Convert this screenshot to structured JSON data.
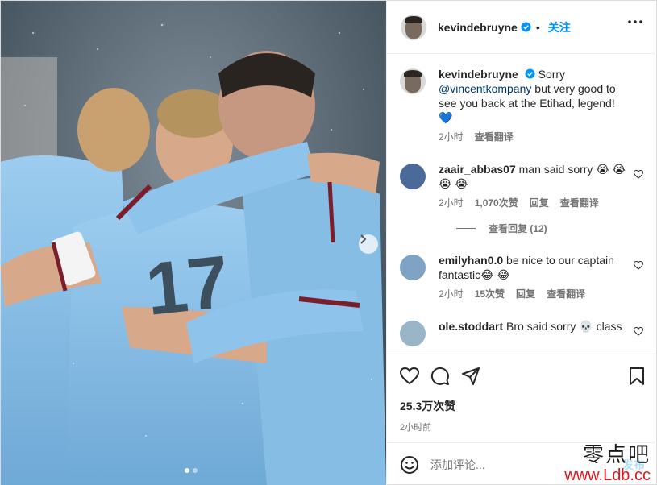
{
  "colors": {
    "accent": "#0095f6",
    "verified": "#0095f6",
    "shirt": "#8ec4ec",
    "maroon": "#7a1e2c",
    "watermark_red": "#e3171c"
  },
  "post": {
    "image_alt": "Manchester City players celebrating in the rain",
    "carousel": {
      "count": 2,
      "active": 0
    },
    "next_icon": "chevron-right-icon"
  },
  "header": {
    "username": "kevindebruyne",
    "verified_icon": "verified-badge-icon",
    "separator": "•",
    "follow_label": "关注",
    "more_icon": "more-horizontal-icon"
  },
  "caption": {
    "username": "kevindebruyne",
    "text_before": "Sorry ",
    "mention": "@vincentkompany",
    "text_after": " but very good to see you back at the Etihad, legend! 💙",
    "time": "2小时",
    "translate": "查看翻译"
  },
  "comments": [
    {
      "username": "zaair_abbas07",
      "text": "man said sorry 😭 😭 😭 😭",
      "time": "2小时",
      "likes": "1,070次赞",
      "reply": "回复",
      "translate": "查看翻译",
      "view_replies": "查看回复 (12)"
    },
    {
      "username": "emilyhan0.0",
      "text": "be nice to our captain fantastic😂 😂",
      "time": "2小时",
      "likes": "15次赞",
      "reply": "回复",
      "translate": "查看翻译"
    },
    {
      "username": "ole.stoddart",
      "text": "Bro said sorry 💀 class"
    }
  ],
  "actions": {
    "like_icon": "heart-icon",
    "comment_icon": "comment-icon",
    "share_icon": "send-icon",
    "save_icon": "bookmark-icon",
    "likes_count": "25.3万次赞",
    "posted_ago": "2小时前"
  },
  "composer": {
    "emoji_icon": "emoji-icon",
    "placeholder": "添加评论...",
    "post_label": "发布"
  },
  "watermark": {
    "cn": "零点吧",
    "en": "www.Ldb.cc"
  }
}
